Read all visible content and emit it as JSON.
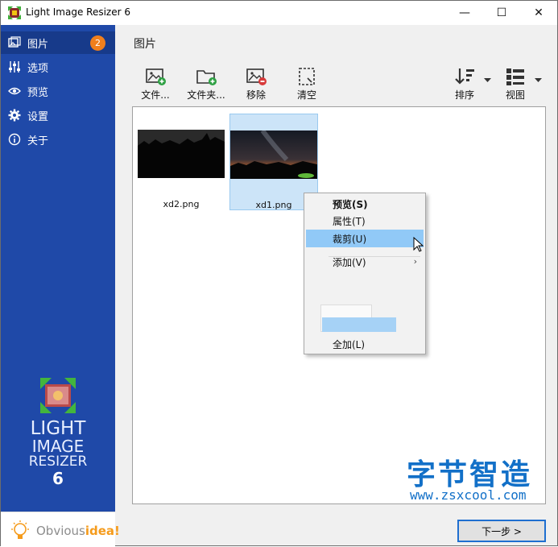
{
  "window": {
    "title": "Light Image Resizer 6",
    "minimize_glyph": "—",
    "maximize_glyph": "☐",
    "close_glyph": "✕"
  },
  "sidebar": {
    "items": [
      {
        "label": "图片",
        "icon": "images-icon",
        "badge": "2",
        "active": true
      },
      {
        "label": "选项",
        "icon": "sliders-icon"
      },
      {
        "label": "预览",
        "icon": "eye-icon"
      },
      {
        "label": "设置",
        "icon": "gear-icon"
      },
      {
        "label": "关于",
        "icon": "info-icon"
      }
    ],
    "logo_lines": [
      "LIGHT",
      "IMAGE",
      "RESIZER",
      "6"
    ],
    "brand_prefix": "Obvious",
    "brand_suffix": "idea!"
  },
  "main": {
    "section_title": "图片",
    "toolbar": {
      "add_files": "文件...",
      "add_folder": "文件夹...",
      "remove": "移除",
      "clear": "清空",
      "sort": "排序",
      "view": "视图"
    },
    "images": [
      {
        "name": "xd2.png",
        "selected": false
      },
      {
        "name": "xd1.png",
        "selected": true
      }
    ]
  },
  "context_menu": {
    "items": [
      {
        "label": "预览(S)",
        "bold": true
      },
      {
        "label": "属性(T)"
      },
      {
        "label": "裁剪(U)",
        "hover": true
      },
      {
        "label": "添加(V)",
        "submenu": true
      },
      {
        "label": "全加(L)"
      }
    ],
    "submenu_glyph": "›"
  },
  "watermark": {
    "chinese": "字节智造",
    "url": "www.zsxcool.com"
  },
  "footer": {
    "next_button": "下一步 >"
  },
  "colors": {
    "sidebar": "#1f49a8",
    "sidebar_active": "#173a8a",
    "badge": "#f07f1c",
    "selection": "#cce4f8",
    "menu_hover": "#91c9f7",
    "accent": "#1270c8"
  }
}
